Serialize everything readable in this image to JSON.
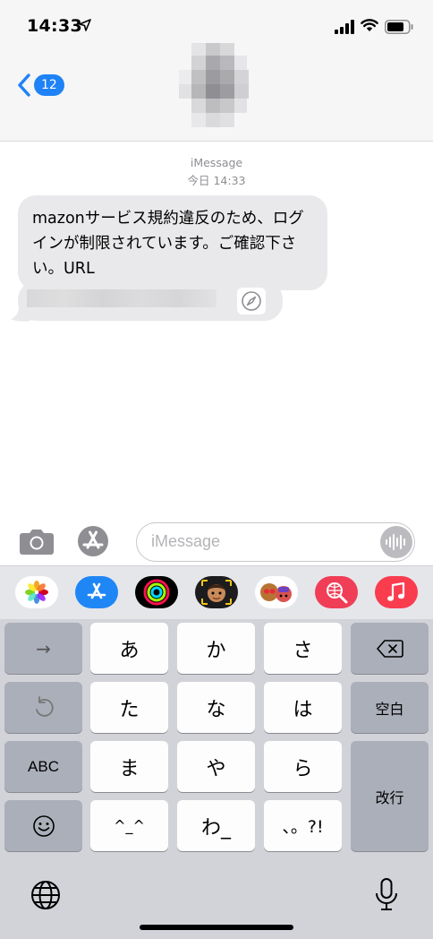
{
  "status_bar": {
    "time": "14:33",
    "icons": [
      "location-arrow-icon",
      "cellular-signal-icon",
      "wifi-icon",
      "battery-icon"
    ]
  },
  "nav": {
    "back_count": "12",
    "contact_avatar": "pixelated-contact-avatar"
  },
  "conversation": {
    "service": "iMessage",
    "timestamp": "今日 14:33",
    "messages": [
      {
        "text": "mazonサービス規約違反のため、ログインが制限されています。ご確認下さい。URL"
      }
    ],
    "link_preview": {
      "url_obscured": true,
      "icon": "safari-compass-icon"
    }
  },
  "input_bar": {
    "placeholder": "iMessage",
    "icons": [
      "camera-icon",
      "app-store-icon",
      "audio-waveform-icon"
    ]
  },
  "app_drawer": [
    {
      "name": "photos-app-icon",
      "bg": "#ffffff"
    },
    {
      "name": "app-store-app-icon",
      "bg": "#1f86f5"
    },
    {
      "name": "activity-app-icon",
      "bg": "#000000"
    },
    {
      "name": "memoji-app-icon",
      "bg": "#1c1c1e"
    },
    {
      "name": "animoji-app-icon",
      "bg": "#ffffff"
    },
    {
      "name": "web-search-app-icon",
      "bg": "#ef3e56"
    },
    {
      "name": "music-app-icon",
      "bg": "#fa3c4f"
    }
  ],
  "keyboard": {
    "rows": [
      [
        "→",
        "あ",
        "か",
        "さ",
        "⌫"
      ],
      [
        "↺",
        "た",
        "な",
        "は",
        "空白"
      ],
      [
        "ABC",
        "ま",
        "や",
        "ら",
        "改行"
      ],
      [
        "☺",
        "^_^",
        "わ_",
        "、。?!"
      ]
    ],
    "bottom": [
      "globe-icon",
      "microphone-icon"
    ]
  }
}
